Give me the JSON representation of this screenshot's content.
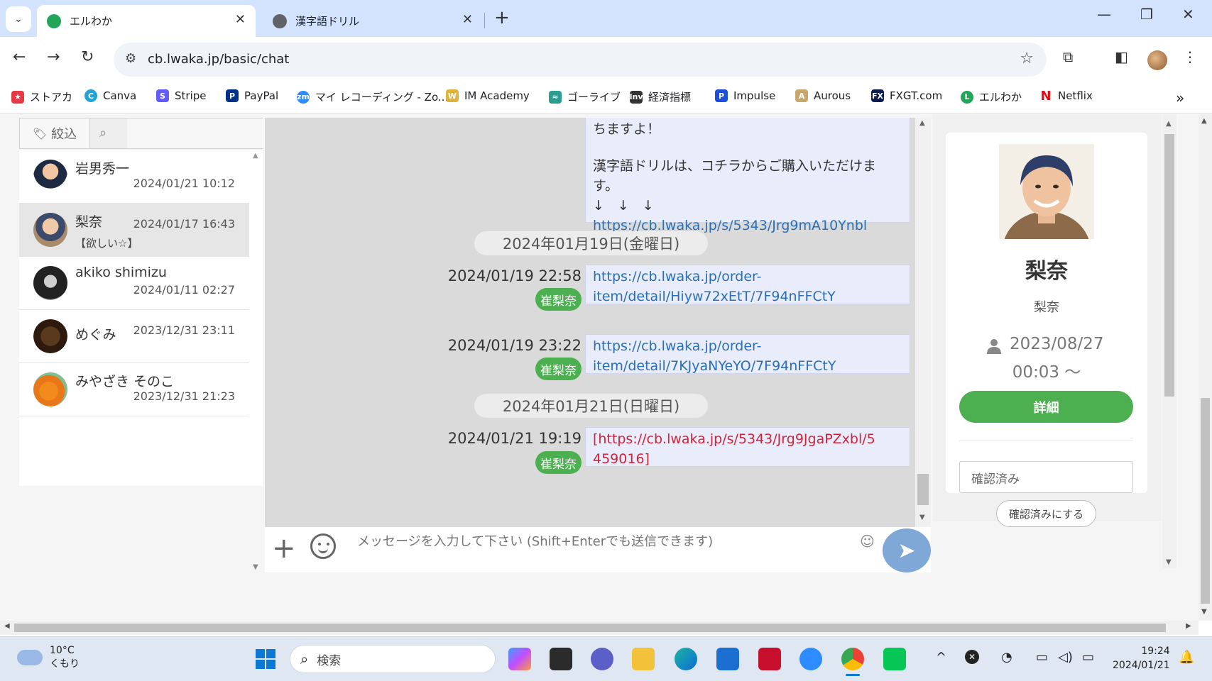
{
  "browser": {
    "tabs": [
      {
        "title": "エルわか",
        "active": true
      },
      {
        "title": "漢字語ドリル",
        "active": false
      }
    ],
    "url": "cb.lwaka.jp/basic/chat",
    "bookmarks": [
      {
        "label": "ストアカ",
        "icon": "storeaka-icon",
        "color": "#e63946"
      },
      {
        "label": "Canva",
        "icon": "canva-icon",
        "color": "#1fa3d9"
      },
      {
        "label": "Stripe",
        "icon": "stripe-icon",
        "color": "#635bff"
      },
      {
        "label": "PayPal",
        "icon": "paypal-icon",
        "color": "#003087"
      },
      {
        "label": "マイ レコーディング - Zo...",
        "icon": "zoom-icon",
        "color": "#2d8cff"
      },
      {
        "label": "IM Academy",
        "icon": "im-academy-icon",
        "color": "#e0b23b"
      },
      {
        "label": "ゴーライブ",
        "icon": "golive-icon",
        "color": "#2a9d8f"
      },
      {
        "label": "経済指標",
        "icon": "investing-icon",
        "color": "#333333"
      },
      {
        "label": "Impulse",
        "icon": "impulse-icon",
        "color": "#1d4ed8"
      },
      {
        "label": "Aurous",
        "icon": "aurous-icon",
        "color": "#c9a66b"
      },
      {
        "label": "FXGT.com",
        "icon": "fxgt-icon",
        "color": "#0b1e4f"
      },
      {
        "label": "エルわか",
        "icon": "lwaka-icon",
        "color": "#22a559"
      },
      {
        "label": "Netflix",
        "icon": "netflix-icon",
        "color": "#e50914"
      }
    ]
  },
  "filter": {
    "tag_label": "絞込"
  },
  "contacts": [
    {
      "name": "岩男秀一",
      "date": "2024/01/21 10:12",
      "preview": "",
      "selected": false
    },
    {
      "name": "梨奈",
      "date": "2024/01/17 16:43",
      "preview": "【欲しい☆】",
      "selected": true
    },
    {
      "name": "akiko shimizu",
      "date": "2024/01/11 02:27",
      "preview": "",
      "selected": false
    },
    {
      "name": "めぐみ",
      "date": "2023/12/31 23:11",
      "preview": "",
      "selected": false
    },
    {
      "name": "みやざき そのこ",
      "date": "2023/12/31 21:23",
      "preview": "",
      "selected": false
    }
  ],
  "chat": {
    "top_bubble": {
      "line1": "ちますよ！",
      "line2": "漢字語ドリルは、コチラからご購入いただけま",
      "line3": "す。",
      "arrows": "↓　↓　↓",
      "link": "https://cb.lwaka.jp/s/5343/Jrg9mA10Ynbl"
    },
    "date_separators": [
      "2024年01月19日(金曜日)",
      "2024年01月21日(日曜日)"
    ],
    "messages": [
      {
        "time": "2024/01/19 22:58",
        "sender": "崔梨奈",
        "line1": "https://cb.lwaka.jp/order-",
        "line2": "item/detail/Hiyw72xEtT/7F94nFFCtY"
      },
      {
        "time": "2024/01/19 23:22",
        "sender": "崔梨奈",
        "line1": "https://cb.lwaka.jp/order-",
        "line2": "item/detail/7KJyaNYeYO/7F94nFFCtY"
      },
      {
        "time": "2024/01/21 19:19",
        "sender": "崔梨奈",
        "line1": "[https://cb.lwaka.jp/s/5343/Jrg9JgaPZxbl/5",
        "line2": "459016]"
      }
    ],
    "input_placeholder": "メッセージを入力して下さい (Shift+Enterでも送信できます)"
  },
  "profile": {
    "name": "梨奈",
    "nickname": "梨奈",
    "since_date": "2023/08/27",
    "since_time": "00:03 〜",
    "detail_button": "詳細",
    "status_value": "確認済み",
    "confirm_button": "確認済みにする"
  },
  "taskbar": {
    "temperature": "10°C",
    "weather": "くもり",
    "search_placeholder": "検索",
    "time": "19:24",
    "date": "2024/01/21"
  },
  "colors": {
    "accent_green": "#4caf50",
    "link_blue": "#2a6fb5",
    "link_red": "#d0243a",
    "tabstrip": "#d3e3fd"
  }
}
